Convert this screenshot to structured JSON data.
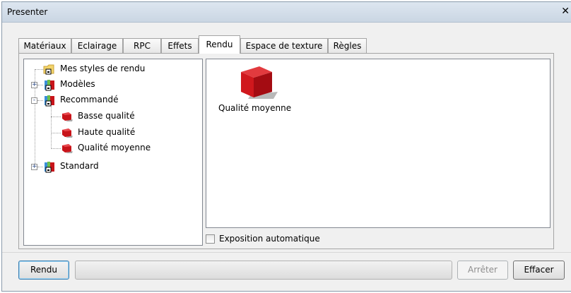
{
  "window": {
    "title": "Presenter"
  },
  "tabs": [
    {
      "label": "Matériaux",
      "active": false
    },
    {
      "label": "Eclairage",
      "active": false
    },
    {
      "label": "RPC",
      "active": false
    },
    {
      "label": "Effets",
      "active": false
    },
    {
      "label": "Rendu",
      "active": true
    },
    {
      "label": "Espace de texture",
      "active": false
    },
    {
      "label": "Règles",
      "active": false
    }
  ],
  "tree": {
    "items": [
      {
        "label": "Mes styles de rendu",
        "icon": "folder-icon",
        "expander": ""
      },
      {
        "label": "Modèles",
        "icon": "library-books-icon",
        "expander": "+"
      },
      {
        "label": "Recommandé",
        "icon": "library-books-icon",
        "expander": "-"
      },
      {
        "label": "Basse qualité",
        "icon": "render-style-icon",
        "expander": ""
      },
      {
        "label": "Haute qualité",
        "icon": "render-style-icon",
        "expander": ""
      },
      {
        "label": "Qualité moyenne",
        "icon": "render-style-icon",
        "expander": ""
      },
      {
        "label": "Standard",
        "icon": "library-books-icon",
        "expander": "+"
      }
    ]
  },
  "preview": {
    "label": "Qualité moyenne",
    "icon": "red-cube-icon"
  },
  "auto_exposure": {
    "label": "Exposition automatique",
    "checked": false
  },
  "footer": {
    "render_label": "Rendu",
    "stop_label": "Arrêter",
    "clear_label": "Effacer",
    "progress": 0
  },
  "colors": {
    "render_red": "#c8141a",
    "folder_yellow": "#f3d46b",
    "accent_blue": "#3c7fb1"
  }
}
